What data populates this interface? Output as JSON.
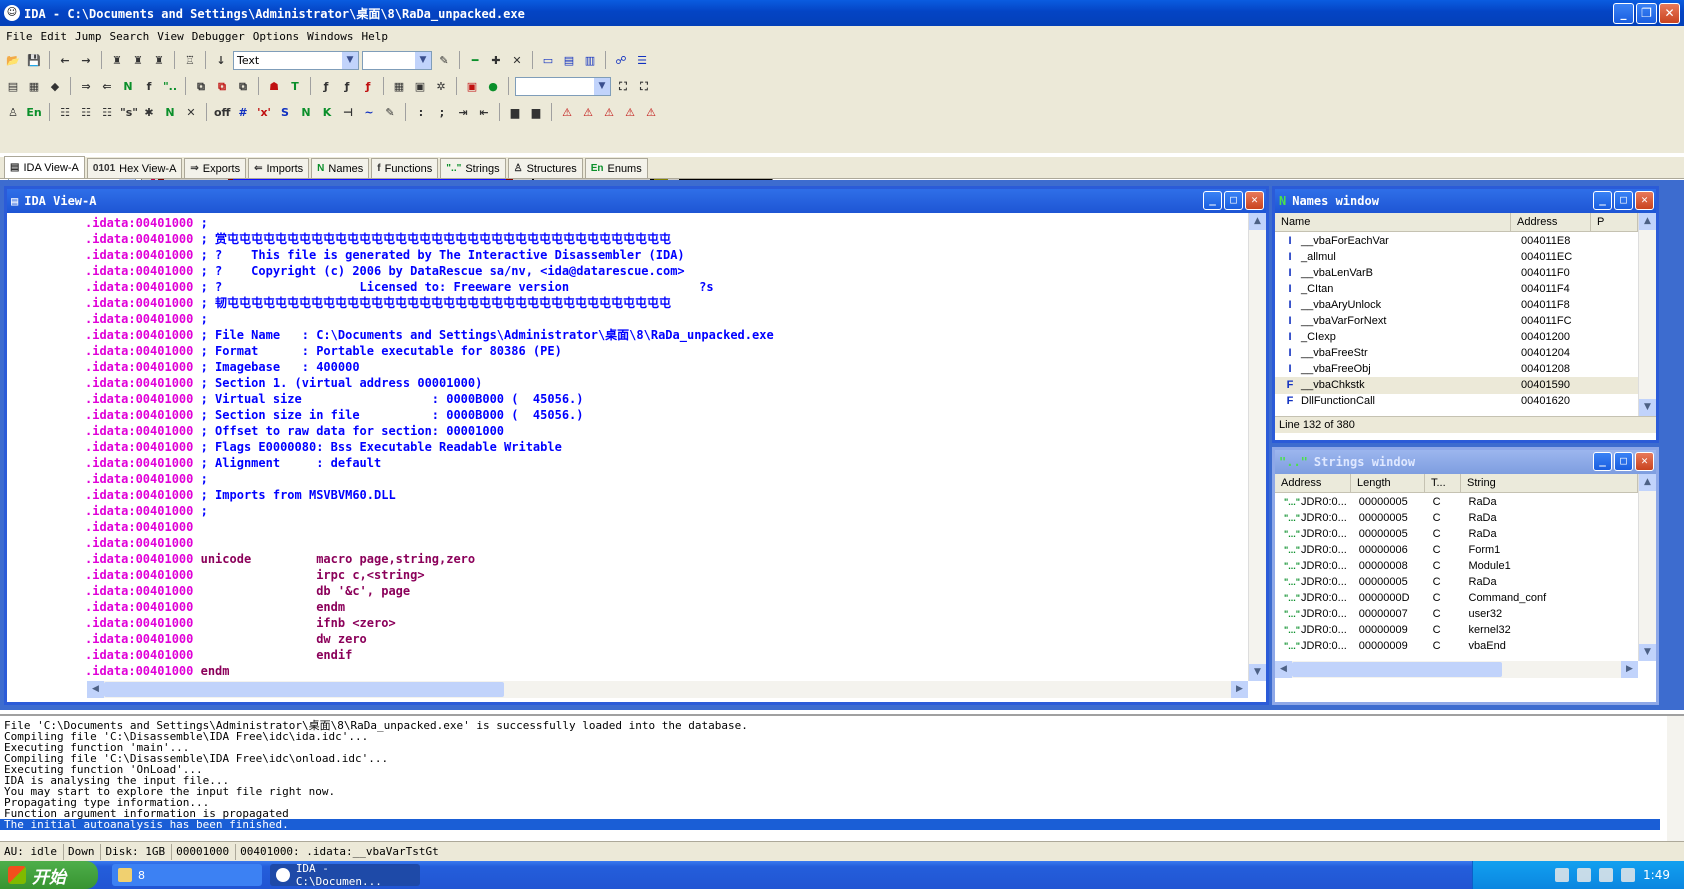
{
  "window": {
    "title": "IDA - C:\\Documents and Settings\\Administrator\\桌面\\8\\RaDa_unpacked.exe",
    "minimize": "_",
    "maximize": "❐",
    "close": "✕"
  },
  "menu": [
    "File",
    "Edit",
    "Jump",
    "Search",
    "View",
    "Debugger",
    "Options",
    "Windows",
    "Help"
  ],
  "toolbar": {
    "mode_select": "Text",
    "search_select": "",
    "segment_select": ""
  },
  "tabs": [
    {
      "icon": "▤",
      "label": "IDA View-A"
    },
    {
      "icon": "0101",
      "label": "Hex View-A"
    },
    {
      "icon": "⇒",
      "label": "Exports"
    },
    {
      "icon": "⇐",
      "label": "Imports"
    },
    {
      "icon": "N",
      "label": "Names"
    },
    {
      "icon": "f",
      "label": "Functions"
    },
    {
      "icon": "\"..\"",
      "label": "Strings"
    },
    {
      "icon": "♙",
      "label": "Structures"
    },
    {
      "icon": "En",
      "label": "Enums"
    }
  ],
  "ida_view": {
    "title": "IDA View-A",
    "lines": [
      {
        "seg": ".idata:00401000",
        "text": " ;",
        "cls": "cmt"
      },
      {
        "seg": ".idata:00401000",
        "text": " ; 赏屯屯屯屯屯屯屯屯屯屯屯屯屯屯屯屯屯屯屯屯屯屯屯屯屯屯屯屯屯屯屯屯屯屯屯屯屯",
        "cls": "cmt"
      },
      {
        "seg": ".idata:00401000",
        "text": " ; ?    This file is generated by The Interactive Disassembler (IDA)",
        "cls": "cmt"
      },
      {
        "seg": ".idata:00401000",
        "text": " ; ?    Copyright (c) 2006 by DataRescue sa/nv, <ida@datarescue.com>",
        "cls": "cmt"
      },
      {
        "seg": ".idata:00401000",
        "text": " ; ?                   Licensed to: Freeware version                  ?s",
        "cls": "cmt"
      },
      {
        "seg": ".idata:00401000",
        "text": " ; 韧屯屯屯屯屯屯屯屯屯屯屯屯屯屯屯屯屯屯屯屯屯屯屯屯屯屯屯屯屯屯屯屯屯屯屯屯屯",
        "cls": "cmt"
      },
      {
        "seg": ".idata:00401000",
        "text": " ;",
        "cls": "cmt"
      },
      {
        "seg": ".idata:00401000",
        "text": " ; File Name   : C:\\Documents and Settings\\Administrator\\桌面\\8\\RaDa_unpacked.exe",
        "cls": "cmt"
      },
      {
        "seg": ".idata:00401000",
        "text": " ; Format      : Portable executable for 80386 (PE)",
        "cls": "cmt"
      },
      {
        "seg": ".idata:00401000",
        "text": " ; Imagebase   : 400000",
        "cls": "cmt"
      },
      {
        "seg": ".idata:00401000",
        "text": " ; Section 1. (virtual address 00001000)",
        "cls": "cmt"
      },
      {
        "seg": ".idata:00401000",
        "text": " ; Virtual size                  : 0000B000 (  45056.)",
        "cls": "cmt"
      },
      {
        "seg": ".idata:00401000",
        "text": " ; Section size in file          : 0000B000 (  45056.)",
        "cls": "cmt"
      },
      {
        "seg": ".idata:00401000",
        "text": " ; Offset to raw data for section: 00001000",
        "cls": "cmt"
      },
      {
        "seg": ".idata:00401000",
        "text": " ; Flags E0000080: Bss Executable Readable Writable",
        "cls": "cmt"
      },
      {
        "seg": ".idata:00401000",
        "text": " ; Alignment     : default",
        "cls": "cmt"
      },
      {
        "seg": ".idata:00401000",
        "text": " ;",
        "cls": "cmt"
      },
      {
        "seg": ".idata:00401000",
        "text": " ; Imports from MSVBVM60.DLL",
        "cls": "cmt"
      },
      {
        "seg": ".idata:00401000",
        "text": " ;",
        "cls": "cmt"
      },
      {
        "seg": ".idata:00401000",
        "text": "",
        "cls": "op"
      },
      {
        "seg": ".idata:00401000",
        "text": "",
        "cls": "op"
      },
      {
        "seg": ".idata:00401000",
        "text": " unicode         macro page,string,zero",
        "cls": "op"
      },
      {
        "seg": ".idata:00401000",
        "text": "                 irpc c,<string>",
        "cls": "op"
      },
      {
        "seg": ".idata:00401000",
        "text": "                 db '&c', page",
        "cls": "op"
      },
      {
        "seg": ".idata:00401000",
        "text": "                 endm",
        "cls": "op"
      },
      {
        "seg": ".idata:00401000",
        "text": "                 ifnb <zero>",
        "cls": "op"
      },
      {
        "seg": ".idata:00401000",
        "text": "                 dw zero",
        "cls": "op"
      },
      {
        "seg": ".idata:00401000",
        "text": "                 endif",
        "cls": "op"
      },
      {
        "seg": ".idata:00401000",
        "text": " endm",
        "cls": "op"
      }
    ]
  },
  "names_window": {
    "title": "Names window",
    "headers": [
      "Name",
      "Address",
      "P"
    ],
    "rows": [
      {
        "icon": "I",
        "name": "__vbaForEachVar",
        "address": "004011E8"
      },
      {
        "icon": "I",
        "name": "_allmul",
        "address": "004011EC"
      },
      {
        "icon": "I",
        "name": "__vbaLenVarB",
        "address": "004011F0"
      },
      {
        "icon": "I",
        "name": "_CItan",
        "address": "004011F4"
      },
      {
        "icon": "I",
        "name": "__vbaAryUnlock",
        "address": "004011F8"
      },
      {
        "icon": "I",
        "name": "__vbaVarForNext",
        "address": "004011FC"
      },
      {
        "icon": "I",
        "name": "_CIexp",
        "address": "00401200"
      },
      {
        "icon": "I",
        "name": "__vbaFreeStr",
        "address": "00401204"
      },
      {
        "icon": "I",
        "name": "__vbaFreeObj",
        "address": "00401208"
      },
      {
        "icon": "F",
        "name": "__vbaChkstk",
        "address": "00401590"
      },
      {
        "icon": "F",
        "name": "DllFunctionCall",
        "address": "00401620"
      }
    ],
    "status": "Line 132 of 380"
  },
  "strings_window": {
    "title": "Strings window",
    "headers": [
      "Address",
      "Length",
      "T...",
      "String"
    ],
    "rows": [
      {
        "address": "JDR0:0...",
        "length": "00000005",
        "type": "C",
        "string": "RaDa"
      },
      {
        "address": "JDR0:0...",
        "length": "00000005",
        "type": "C",
        "string": "RaDa"
      },
      {
        "address": "JDR0:0...",
        "length": "00000005",
        "type": "C",
        "string": "RaDa"
      },
      {
        "address": "JDR0:0...",
        "length": "00000006",
        "type": "C",
        "string": "Form1"
      },
      {
        "address": "JDR0:0...",
        "length": "00000008",
        "type": "C",
        "string": "Module1"
      },
      {
        "address": "JDR0:0...",
        "length": "00000005",
        "type": "C",
        "string": "RaDa"
      },
      {
        "address": "JDR0:0...",
        "length": "0000000D",
        "type": "C",
        "string": "Command_conf"
      },
      {
        "address": "JDR0:0...",
        "length": "00000007",
        "type": "C",
        "string": "user32"
      },
      {
        "address": "JDR0:0...",
        "length": "00000009",
        "type": "C",
        "string": "kernel32"
      },
      {
        "address": "JDR0:0...",
        "length": "00000009",
        "type": "C",
        "string": "   vbaEnd"
      }
    ]
  },
  "output": [
    "File 'C:\\Documents and Settings\\Administrator\\桌面\\8\\RaDa_unpacked.exe' is successfully loaded into the database.",
    "Compiling file 'C:\\Disassemble\\IDA Free\\idc\\ida.idc'...",
    "Executing function 'main'...",
    "Compiling file 'C:\\Disassemble\\IDA Free\\idc\\onload.idc'...",
    "Executing function 'OnLoad'...",
    "IDA is analysing the input file...",
    "You may start to explore the input file right now.",
    "Propagating type information...",
    "Function argument information is propagated",
    "The initial autoanalysis has been finished."
  ],
  "statusbar": {
    "au": "AU:  idle",
    "dir": "Down",
    "disk": "Disk: 1GB",
    "offset": "00001000",
    "location": "00401000: .idata:__vbaVarTstGt"
  },
  "taskbar": {
    "start": "开始",
    "tasks": [
      "8",
      "IDA - C:\\Documen..."
    ],
    "clock": "1:49"
  },
  "colors": {
    "segment": "#e000d8",
    "comment": "#0000ff",
    "code": "#8b005a",
    "caption_active": "#1e55d4"
  }
}
